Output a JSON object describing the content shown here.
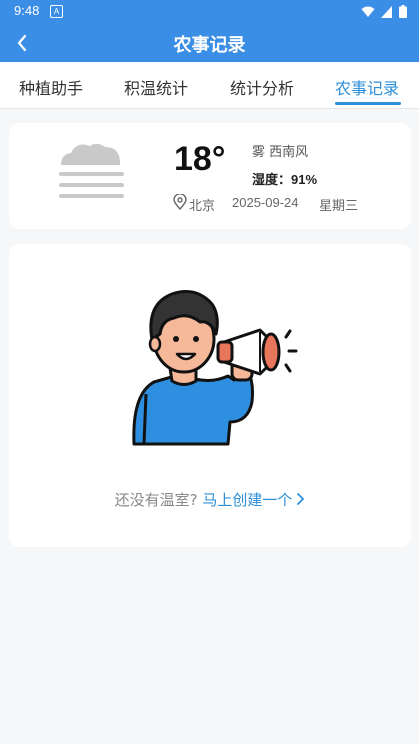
{
  "status_bar": {
    "time": "9:48",
    "app_icon": "A"
  },
  "app_bar": {
    "title": "农事记录",
    "back_icon": "chevron-left-icon"
  },
  "tabs": [
    {
      "label": "种植助手",
      "active": false
    },
    {
      "label": "积温统计",
      "active": false
    },
    {
      "label": "统计分析",
      "active": false
    },
    {
      "label": "农事记录",
      "active": true
    }
  ],
  "weather": {
    "icon": "fog-icon",
    "temperature": "18°",
    "condition": "雾 西南风",
    "humidity_label": "湿度：",
    "humidity_value": "91%",
    "city": "北京",
    "date": "2025-09-24",
    "weekday": "星期三"
  },
  "empty_state": {
    "illustration": "person-megaphone-illustration",
    "hint": "还没有温室?",
    "link": "马上创建一个"
  },
  "colors": {
    "primary": "#3a8ee6",
    "tab_active": "#2d8fd8",
    "background": "#f6f7f9"
  }
}
